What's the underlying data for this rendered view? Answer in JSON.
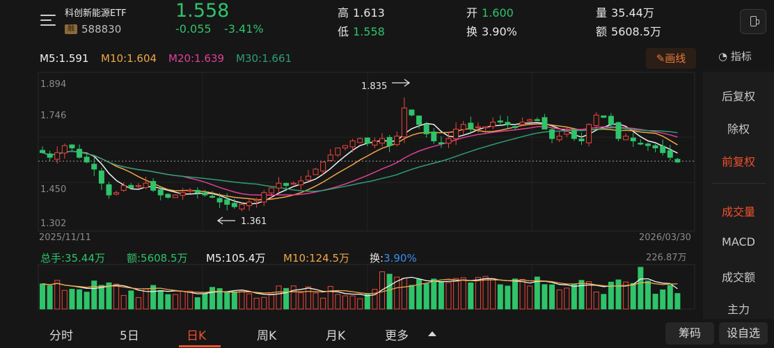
{
  "header": {
    "name": "科创新能源ETF",
    "badge": "融",
    "code": "588830",
    "price": "1.558",
    "change": "-0.055",
    "change_pct": "-3.41%",
    "stats": {
      "high_label": "高",
      "high_value": "1.613",
      "low_label": "低",
      "low_value": "1.558",
      "open_label": "开",
      "open_value": "1.600",
      "turnover_label": "换",
      "turnover_value": "3.90%",
      "volume_label": "量",
      "volume_value": "35.44万",
      "amount_label": "额",
      "amount_value": "5608.5万"
    }
  },
  "ma_legend": {
    "ma5": "M5:1.591",
    "ma10": "M10:1.604",
    "ma20": "M20:1.639",
    "ma30": "M30:1.661"
  },
  "toolbar": {
    "draw_label": "画线",
    "indicator_label": "指标"
  },
  "side_panel": {
    "items": [
      "后复权",
      "除权",
      "前复权",
      "成交量",
      "MACD",
      "成交额",
      "主力"
    ],
    "active": "前复权"
  },
  "chart": {
    "y_ticks": [
      "1.894",
      "1.746",
      "1.450",
      "1.302"
    ],
    "start_date": "2025/11/11",
    "end_date": "2026/03/30",
    "max_label": "1.835",
    "min_label": "1.361",
    "volume_max_label": "226.87万"
  },
  "volume_legend": {
    "total": "总手:35.44万",
    "amount": "额:5608.5万",
    "m5": "M5:105.4万",
    "m10": "M10:124.5万",
    "turnover_label": "换:",
    "turnover_value": "3.90%"
  },
  "bottom_tabs": [
    "分时",
    "5日",
    "日K",
    "周K",
    "月K",
    "更多"
  ],
  "active_tab": "日K",
  "bottom_buttons": {
    "chips": "筹码",
    "watchlist": "设自选"
  },
  "colors": {
    "up": "#f0473c",
    "down": "#2fc36a",
    "ma5": "#f2f2f2",
    "ma10": "#f0a646",
    "ma20": "#e0409a",
    "ma30": "#2e9e78",
    "accent": "#f0502c"
  },
  "chart_data": {
    "type": "candlestick",
    "y_range": [
      1.302,
      1.894
    ],
    "date_range": [
      "2025/11/11",
      "2026/03/30"
    ],
    "close_path": [
      1.6,
      1.58,
      1.6,
      1.63,
      1.62,
      1.58,
      1.56,
      1.53,
      1.47,
      1.42,
      1.43,
      1.46,
      1.45,
      1.46,
      1.47,
      1.44,
      1.42,
      1.41,
      1.42,
      1.43,
      1.44,
      1.43,
      1.42,
      1.41,
      1.39,
      1.38,
      1.37,
      1.38,
      1.39,
      1.4,
      1.43,
      1.45,
      1.47,
      1.46,
      1.47,
      1.48,
      1.5,
      1.53,
      1.56,
      1.59,
      1.62,
      1.63,
      1.65,
      1.66,
      1.64,
      1.65,
      1.66,
      1.63,
      1.67,
      1.79,
      1.76,
      1.72,
      1.68,
      1.65,
      1.64,
      1.66,
      1.7,
      1.72,
      1.7,
      1.71,
      1.71,
      1.73,
      1.73,
      1.72,
      1.71,
      1.73,
      1.74,
      1.74,
      1.7,
      1.66,
      1.67,
      1.69,
      1.66,
      1.65,
      1.72,
      1.76,
      1.75,
      1.72,
      1.66,
      1.67,
      1.65,
      1.64,
      1.63,
      1.62,
      1.6,
      1.58,
      1.56
    ],
    "last_close": 1.558,
    "marked_high": 1.835,
    "marked_low": 1.361,
    "volume_max": "226.87万"
  }
}
